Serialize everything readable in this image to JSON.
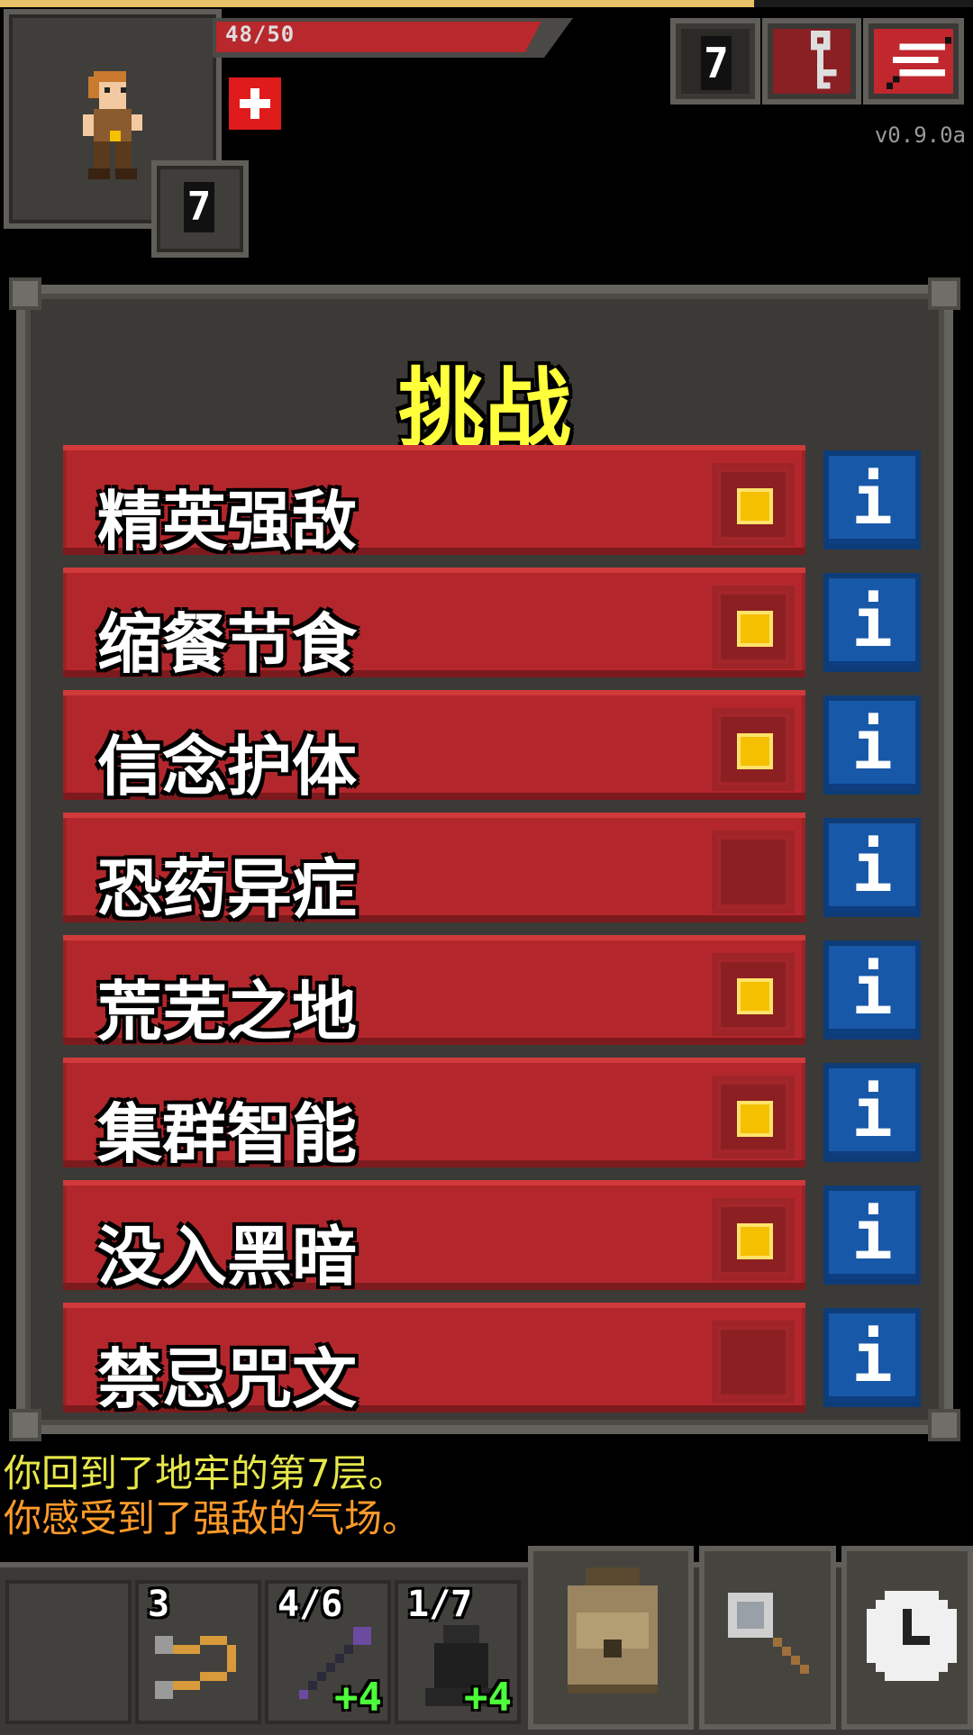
{
  "hud": {
    "hp_text": "48/50",
    "hp_fraction": 0.96,
    "xp_fraction": 0.775,
    "depth": "7",
    "journal_depth": "7",
    "version": "v0.9.0a",
    "buff_icon": "health-cross-icon"
  },
  "dialog": {
    "title": "挑战",
    "challenges": [
      {
        "label": "精英强敌",
        "enabled": true
      },
      {
        "label": "缩餐节食",
        "enabled": true
      },
      {
        "label": "信念护体",
        "enabled": true
      },
      {
        "label": "恐药异症",
        "enabled": false
      },
      {
        "label": "荒芜之地",
        "enabled": true
      },
      {
        "label": "集群智能",
        "enabled": true
      },
      {
        "label": "没入黑暗",
        "enabled": true
      },
      {
        "label": "禁忌咒文",
        "enabled": false
      }
    ],
    "info_glyph": "i"
  },
  "log": {
    "line1": "你回到了地牢的第7层。",
    "line2": "你感受到了强敌的气场。",
    "line1_color": "#e6e64a",
    "line2_color": "#ff9a2a"
  },
  "quickslots": [
    {
      "icon": "whip-icon",
      "count": "3",
      "level": ""
    },
    {
      "icon": "wand-icon",
      "count": "4/6",
      "level": "+4"
    },
    {
      "icon": "cloak-icon",
      "count": "1/7",
      "level": "+4"
    }
  ],
  "colors": {
    "row_red": "#b3272c",
    "checkbox_on": "#f5c000",
    "info_blue": "#1858a8",
    "title_yellow": "#ffff3c"
  }
}
